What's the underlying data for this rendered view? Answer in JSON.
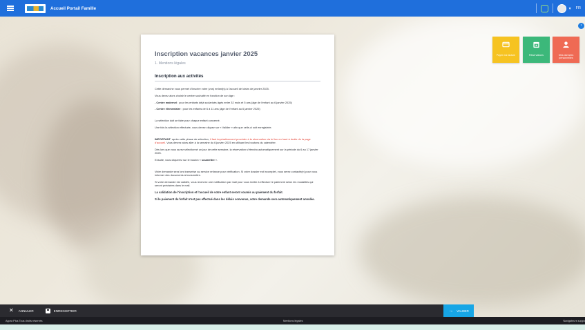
{
  "app": {
    "title": "Accueil Portail Famille",
    "language": "FR"
  },
  "tiles": [
    {
      "label": "Payer ma facture",
      "color": "#f6c321",
      "icon": "card-icon"
    },
    {
      "label": "Réservations",
      "color": "#3cb87a",
      "icon": "calendar-icon"
    },
    {
      "label": "Mes données personnelles",
      "color": "#ef6a54",
      "icon": "user-icon"
    }
  ],
  "document": {
    "title": "Inscription vacances janvier 2025",
    "step": "1. Mentions légales",
    "section_title": "Inscription aux activités",
    "p1": "Cette démarche vous permet d'inscrire votre (vos) enfant(s) à l'accueil de loisirs de janvier 2025.",
    "p2": "Vous devez alors choisir le centre souhaité en fonction de son âge :",
    "p3_bold": "- Centre maternel",
    "p3": " : pour les enfants déjà scolarisés âgés entre 32 mois et 5 ans (âge de l'enfant au 6 janvier 2025)",
    "p4_bold": "- Centre élémentaire",
    "p4": " : pour les enfants de 6 à 11 ans (âge de l'enfant au 6 janvier 2025)",
    "p5": "La sélection doit se faire pour chaque enfant concerné.",
    "p6": "Une fois la sélection effectuée, vous devez cliquez sur « Valider » afin que celle-ci soit enregistrée.",
    "p7_bold": "IMPORTANT",
    "p7_a": ": après cette phase de sélection, ",
    "p7_red": "il faut impérativement procéder à la réservation via le lien en haut à droite de la page d'accueil.",
    "p7_b": " Vous devrez alors aller à la semaine du 6 janvier 2025 en utilisant les boutons du calendrier.",
    "p8": "Dès lors que vous aurez sélectionné un jour de cette semaine, la réservation s'étendra automatiquement sur la période du 6 au 17 janvier 2025.",
    "p9_a": "Ensuite, vous cliquerez sur le bouton « ",
    "p9_bold": "soumettre",
    "p9_b": " ».",
    "p10": "Votre demande sera lors transmise au service enfance pour vérification. Si votre dossier est incomplet, vous serez contacté(e) pour vous informer des documents à transmettre.",
    "p11": "Si votre demande est validée, vous recevrez une notification par mail pour vous inviter à effectuer le paiement selon les modalités qui seront précisées dans le mail.",
    "p12": "La validation de l'inscription et l'accueil de votre enfant seront soumis au paiement du forfait.",
    "p13": "Si le paiement du forfait n'est pas effectué dans les délais convenus, votre demande sera automatiquement annulée."
  },
  "actions": {
    "cancel": "ANNULER",
    "save": "ENREGISTRER",
    "validate": "VALIDER"
  },
  "footer": {
    "left": "Agora Plus Tous droits réservés",
    "middle": "Mentions légales",
    "right": "Navigateurs suppo"
  }
}
